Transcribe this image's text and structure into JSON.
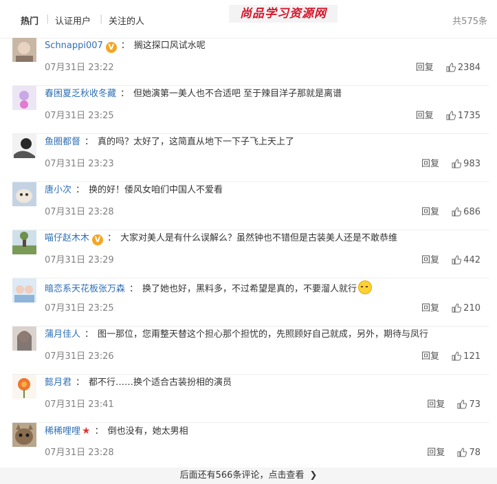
{
  "tabs": [
    {
      "label": "热门"
    },
    {
      "label": "认证用户"
    },
    {
      "label": "关注的人"
    }
  ],
  "watermark": "尚品学习资源网",
  "total": "共575条",
  "comments": [
    {
      "user": "Schnappi007",
      "badge": "V",
      "text": "搁这探口风试水呢",
      "time": "07月31日 23:22",
      "reply": "回复",
      "likes": "2384"
    },
    {
      "user": "春困夏乏秋收冬藏",
      "text": "但她演第一美人也不合适吧 至于辣目洋子那就是离谱",
      "time": "07月31日 23:25",
      "reply": "回复",
      "likes": "1735"
    },
    {
      "user": "鱼圈都督",
      "text": "真的吗？太好了，这简直从地下一下子飞上天上了",
      "time": "07月31日 23:23",
      "reply": "回复",
      "likes": "983"
    },
    {
      "user": "唐小次",
      "text": "换的好！倭风女咱们中国人不爱看",
      "time": "07月31日 23:28",
      "reply": "回复",
      "likes": "686"
    },
    {
      "user": "喵仔赵木木",
      "badge": "V",
      "text": "大家对美人是有什么误解么？虽然钟也不错但是古装美人还是不敢恭维",
      "time": "07月31日 23:29",
      "reply": "回复",
      "likes": "442"
    },
    {
      "user": "暗恋系天花板张万森",
      "text": "换了她也好，黑料多，不过希望是真的，不要溜人就行",
      "emoji": "sweat-smile-emoji",
      "time": "07月31日 23:25",
      "reply": "回复",
      "likes": "210"
    },
    {
      "user": "蒲月佳人",
      "text": "图一那位，您甭整天替这个担心那个担忧的，先照顾好自己就成，另外，期待与凤行",
      "time": "07月31日 23:26",
      "reply": "回复",
      "likes": "121"
    },
    {
      "user": "懿月君",
      "text": "都不行……换个适合古装扮相的演员",
      "time": "07月31日 23:41",
      "reply": "回复",
      "likes": "73"
    },
    {
      "user": "稀稀哩哩",
      "star": "★",
      "text": "倒也没有，她太男相",
      "time": "07月31日 23:28",
      "reply": "回复",
      "likes": "78"
    }
  ],
  "more": {
    "label": "后面还有566条评论，点击查看",
    "arrow": "❯"
  },
  "colors": {
    "username": "#2e6fb5",
    "badge": "#f5a623",
    "watermark": "#d5142a"
  }
}
